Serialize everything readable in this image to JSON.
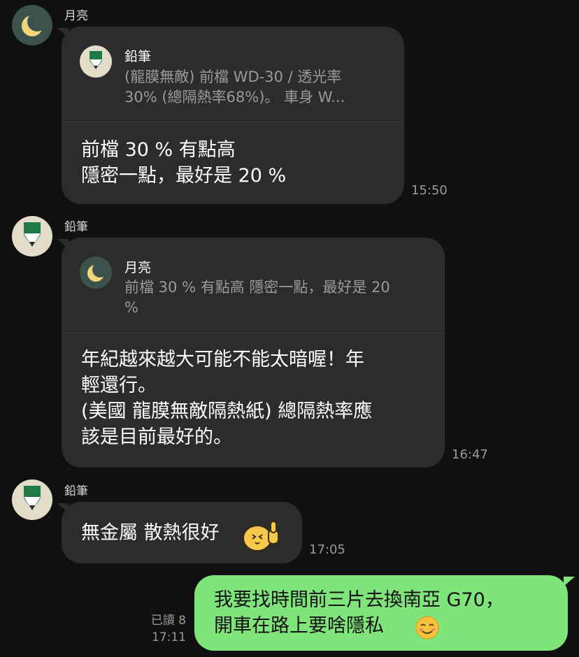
{
  "messages": [
    {
      "sender": "月亮",
      "quote": {
        "name": "鉛筆",
        "line1": "(龍膜無敵) 前檔 WD-30 / 透光率",
        "line2": "30% (總隔熱率68%)。 車身 W..."
      },
      "line1": "前檔 30 % 有點高",
      "line2": "隱密一點，最好是 20 %",
      "time": "15:50"
    },
    {
      "sender": "鉛筆",
      "quote": {
        "name": "月亮",
        "line1": "前檔 30 % 有點高 隱密一點，最好是 20",
        "line2": "%"
      },
      "line1": "年紀越來越大可能不能太暗喔！年",
      "line2": "輕還行。",
      "line3": "(美國 龍膜無敵隔熱紙) 總隔熱率應",
      "line4": "該是目前最好的。",
      "time": "16:47"
    },
    {
      "sender": "鉛筆",
      "text": "無金屬 散熱很好",
      "sticker": "thumbs-up-chick-sticker",
      "time": "17:05"
    },
    {
      "line1": "我要找時間前三片去換南亞 G70，",
      "line2": "開車在路上要啥隱私",
      "emoji": "smiling-face-emoji",
      "read_status": "已讀 8",
      "time": "17:11"
    }
  ],
  "colors": {
    "background": "#101010",
    "incoming_bubble": "#2c2c2e",
    "outgoing_bubble": "#7fe57a",
    "secondary_text": "#9a9a9a"
  }
}
